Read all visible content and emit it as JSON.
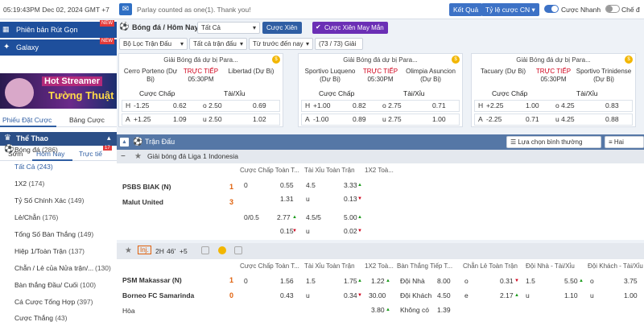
{
  "topbar": {
    "clock": "05:19:43PM Dec 02, 2024 GMT +7",
    "notice": "Parlay counted as one(1). Thank you!",
    "login": "Kết Quả",
    "odds_type": "Tỷ lệ cược CN",
    "fast_bet": "Cược Nhanh",
    "mode": "Chế đ"
  },
  "sidebar": {
    "promo1": "Phiên bản Rút Gọn",
    "promo2": "Galaxy",
    "badge": "NEW",
    "banner1": "Hot Streamer",
    "banner2": "Tường Thuật",
    "tab_slip": "Phiếu Đặt Cược",
    "tab_table": "Bảng Cược",
    "sport_head": "Thể Thao",
    "tab_early": "Sớm",
    "tab_today": "Hôm Nay",
    "tab_live": "Trực tiế",
    "live_count": "17",
    "items": [
      {
        "label": "Bóng đá",
        "count": "(286)"
      },
      {
        "label": "Tất Cả",
        "count": "(243)"
      },
      {
        "label": "1X2",
        "count": "(174)"
      },
      {
        "label": "Tỷ Số Chính Xác",
        "count": "(149)"
      },
      {
        "label": "Lẻ/Chẵn",
        "count": "(176)"
      },
      {
        "label": "Tổng Số Bàn Thắng",
        "count": "(149)"
      },
      {
        "label": "Hiệp 1/Toàn Trận",
        "count": "(137)"
      },
      {
        "label": "Chẵn / Lẻ của Nửa trận/...",
        "count": "(130)"
      },
      {
        "label": "Bàn thắng Đầu/ Cuối",
        "count": "(100)"
      },
      {
        "label": "Cá Cược Tổng Hợp",
        "count": "(397)"
      },
      {
        "label": "Cược Thắng",
        "count": "(43)"
      }
    ]
  },
  "filters": {
    "sport": "Bóng đá / Hôm Nay",
    "all": "Tất Cả",
    "parlay": "Cược Xiên",
    "lucky": "Cược Xiên May Mắn",
    "league_filter": "Bộ Lọc Trận Đấu",
    "all_matches": "Tất cả trận đấu",
    "sort": "Từ trước đến nay",
    "count": "(73 / 73) Giải"
  },
  "cards": [
    {
      "league": "Giải Bóng đá dự bị Para...",
      "home": "Cerro Porteno (Dự Bị)",
      "away": "Libertad (Dự Bị)",
      "live": "TRỰC TIẾP",
      "time": "05:30PM",
      "hdp": "Cược Chấp",
      "ou": "Tài/Xỉu",
      "r1": [
        "H",
        "-1.25",
        "0.62",
        "o 2.50",
        "0.69"
      ],
      "r2": [
        "A",
        "+1.25",
        "1.09",
        "u 2.50",
        "1.02"
      ]
    },
    {
      "league": "Giải Bóng đá dự bị Para...",
      "home": "Sportivo Luqueno (Dự Bị)",
      "away": "Olimpia Asuncion (Dự Bị)",
      "live": "TRỰC TIẾP",
      "time": "05:30PM",
      "hdp": "Cược Chấp",
      "ou": "Tài/Xỉu",
      "r1": [
        "H",
        "+1.00",
        "0.82",
        "o 2.75",
        "0.71"
      ],
      "r2": [
        "A",
        "-1.00",
        "0.89",
        "u 2.75",
        "1.00"
      ]
    },
    {
      "league": "Giải Bóng đá dự bị Para...",
      "home": "Tacuary (Dự Bị)",
      "away": "Sportivo Trinidense (Dự Bị)",
      "live": "TRỰC TIẾP",
      "time": "05:30PM",
      "hdp": "Cược Chấp",
      "ou": "Tài/Xỉu",
      "r1": [
        "H",
        "+2.25",
        "1.00",
        "o 4.25",
        "0.83"
      ],
      "r2": [
        "A",
        "-2.25",
        "0.71",
        "u 4.25",
        "0.88"
      ]
    }
  ],
  "section": {
    "title": "Trận Đấu",
    "view": "Lựa chọn bình thường",
    "lines": "Hai Dòng"
  },
  "league1": {
    "name": "Giải bóng đá Liga 1 Indonesia",
    "h1": "Cược Chấp Toàn T...",
    "h2": "Tài Xỉu Toàn Trận",
    "h3": "1X2 Toà...",
    "home": "PSBS BIAK (N)",
    "away": "Malut United",
    "sh": "1",
    "sa": "3",
    "m1": {
      "hl": "0",
      "hv": "0.55",
      "ol": "4.5",
      "ov": "3.33"
    },
    "m2": {
      "hv": "1.31",
      "ol": "u",
      "ov": "0.13"
    },
    "m3": {
      "hl": "0/0.5",
      "hv": "2.77",
      "ol": "4.5/5",
      "ov": "5.00"
    },
    "m4": {
      "hv": "0.15",
      "ol": "u",
      "ov": "0.02"
    }
  },
  "league2": {
    "inj": "Inj.",
    "period": "2H",
    "minute": "46'",
    "plus": "+5",
    "h1": "Cược Chấp Toàn T...",
    "h2": "Tài Xỉu Toàn Trận",
    "h3": "1X2 Toà...",
    "h4": "Bàn Thắng Tiếp T...",
    "h5": "Chẵn Lẻ Toàn Trận",
    "h6": "Đội Nhà - Tài/Xỉu",
    "h7": "Đội Khách - Tài/Xỉu",
    "home": "PSM Makassar (N)",
    "away": "Borneo FC Samarinda",
    "draw": "Hòa",
    "sh": "1",
    "sa": "0",
    "r1": {
      "hl": "0",
      "hv": "1.56",
      "ol": "1.5",
      "ov": "1.75",
      "x": "1.22",
      "ng": "Đội Nhà",
      "ngv": "8.00",
      "oe": "o",
      "oev": "0.31",
      "hou": "1.5",
      "houv": "5.50",
      "aou": "o",
      "aouv": "3.75"
    },
    "r2": {
      "hv": "0.43",
      "ol": "u",
      "ov": "0.34",
      "x": "30.00",
      "ng": "Đội Khách",
      "ngv": "4.50",
      "oe": "e",
      "oev": "2.17",
      "hou": "u",
      "houv": "1.10",
      "aou": "u",
      "aouv": "1.00"
    },
    "r3": {
      "x": "3.80",
      "ng": "Không có",
      "ngv": "1.39"
    }
  }
}
